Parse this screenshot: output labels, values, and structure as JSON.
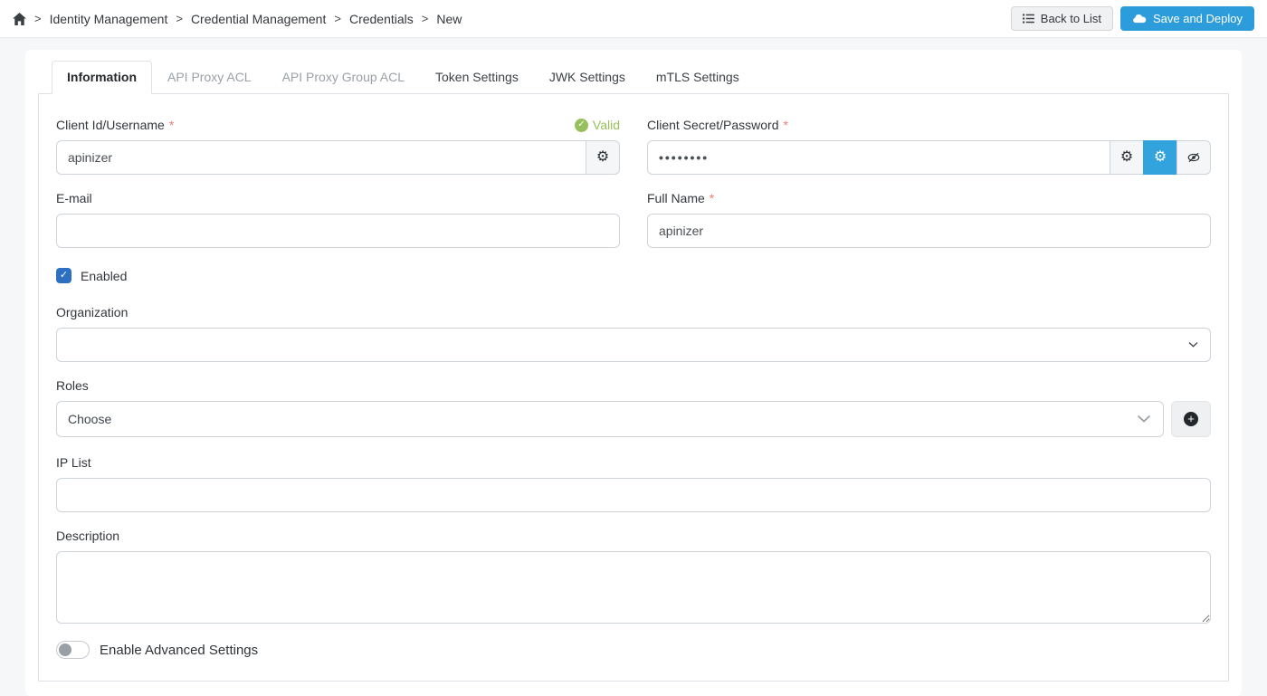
{
  "breadcrumb": {
    "separator": ">",
    "items": [
      "Identity Management",
      "Credential Management",
      "Credentials",
      "New"
    ]
  },
  "header": {
    "back_to_list_label": "Back to List",
    "save_and_deploy_label": "Save and Deploy"
  },
  "tabs": [
    {
      "label": "Information",
      "state": "active"
    },
    {
      "label": "API Proxy ACL",
      "state": "disabled"
    },
    {
      "label": "API Proxy Group ACL",
      "state": "disabled"
    },
    {
      "label": "Token Settings",
      "state": "normal"
    },
    {
      "label": "JWK Settings",
      "state": "normal"
    },
    {
      "label": "mTLS Settings",
      "state": "normal"
    }
  ],
  "form": {
    "client_id": {
      "label": "Client Id/Username",
      "required_mark": "*",
      "value": "apinizer",
      "status": "Valid"
    },
    "client_secret": {
      "label": "Client Secret/Password",
      "required_mark": "*",
      "value": "••••••••"
    },
    "email": {
      "label": "E-mail",
      "value": ""
    },
    "full_name": {
      "label": "Full Name",
      "required_mark": "*",
      "value": "apinizer"
    },
    "enabled": {
      "label": "Enabled",
      "checked": true,
      "check_glyph": "✓"
    },
    "organization": {
      "label": "Organization",
      "value": ""
    },
    "roles": {
      "label": "Roles",
      "placeholder": "Choose"
    },
    "ip_list": {
      "label": "IP List",
      "value": ""
    },
    "description": {
      "label": "Description",
      "value": ""
    },
    "advanced_settings": {
      "label": "Enable Advanced Settings",
      "enabled": false
    }
  },
  "colors": {
    "accent_blue": "#2d9cdb",
    "gear_active_blue": "#32a3dc",
    "checkbox_blue": "#2d6fc0",
    "valid_green": "#97c05c",
    "required_red": "#ee7b72",
    "border_gray": "#ced4da"
  }
}
